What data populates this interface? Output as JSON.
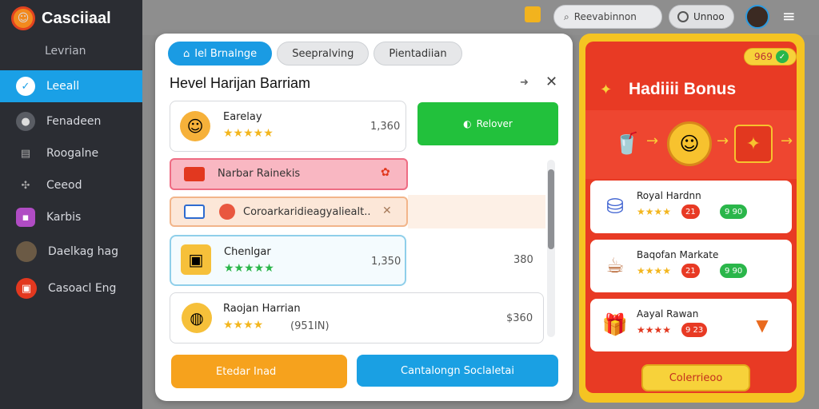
{
  "app": {
    "brand": "Casciiaal",
    "brand_icon": "game-logo-icon"
  },
  "sidebar": {
    "subtitle": "Levrian",
    "items": [
      {
        "label": "Leeall",
        "icon": "chat-bubble-icon",
        "active": true
      },
      {
        "label": "Fenadeen",
        "icon": "chat-icon",
        "active": false
      },
      {
        "label": "Roogalne",
        "icon": "chest-icon",
        "active": false
      },
      {
        "label": "Ceeod",
        "icon": "gamepad-icon",
        "active": false
      },
      {
        "label": "Karbis",
        "icon": "purple-box-icon",
        "active": false
      },
      {
        "label": "Daelkag hag",
        "icon": "avatar-icon",
        "active": false
      },
      {
        "label": "Casoacl Eng",
        "icon": "red-gift-icon",
        "active": false
      }
    ]
  },
  "topbar": {
    "search_label": "Reevabinnon",
    "undo_label": "Unnoo",
    "menu_icon": "hamburger-menu-icon"
  },
  "panel": {
    "tabs": [
      {
        "label": "Iel Brnalnge",
        "active": true
      },
      {
        "label": "Seepralving",
        "active": false
      },
      {
        "label": "Pientadiian",
        "active": false
      }
    ],
    "title": "Hevel Harijan Barriam",
    "cards": [
      {
        "name": "Earelay",
        "stars": "★★★★★",
        "value": "1,360"
      },
      {
        "name": "Chenlgar",
        "stars": "★★★★★",
        "value": "1,350",
        "extra": "380"
      },
      {
        "name": "Raojan Harrian",
        "stars": "★★★★",
        "value": "$360",
        "note": "(951IN)"
      }
    ],
    "renew_label": "Relover",
    "pink_row": "Narbar Rainekis",
    "peach_row": "Coroarkaridieagyaliealt..",
    "btn_orange": "Etedar Inad",
    "btn_blue": "Cantalongn Soclaletai",
    "colors": {
      "accent": "#1a9be3",
      "green": "#22c13c",
      "orange": "#f6a21d"
    }
  },
  "bonus": {
    "coins": "969",
    "title": "Hadiiii Bonus",
    "items": [
      {
        "name": "Royal Hardnn",
        "stars": "★★★★",
        "badge_red": "21",
        "badge_green": "9 90"
      },
      {
        "name": "Baqofan Markate",
        "stars": "★★★★",
        "badge_red": "21",
        "badge_green": "9 90"
      },
      {
        "name": "Aayal Rawan",
        "stars": "★★★★",
        "badge_red": "9 23",
        "badge_green": ""
      }
    ],
    "collect_label": "Colerrieoo"
  }
}
